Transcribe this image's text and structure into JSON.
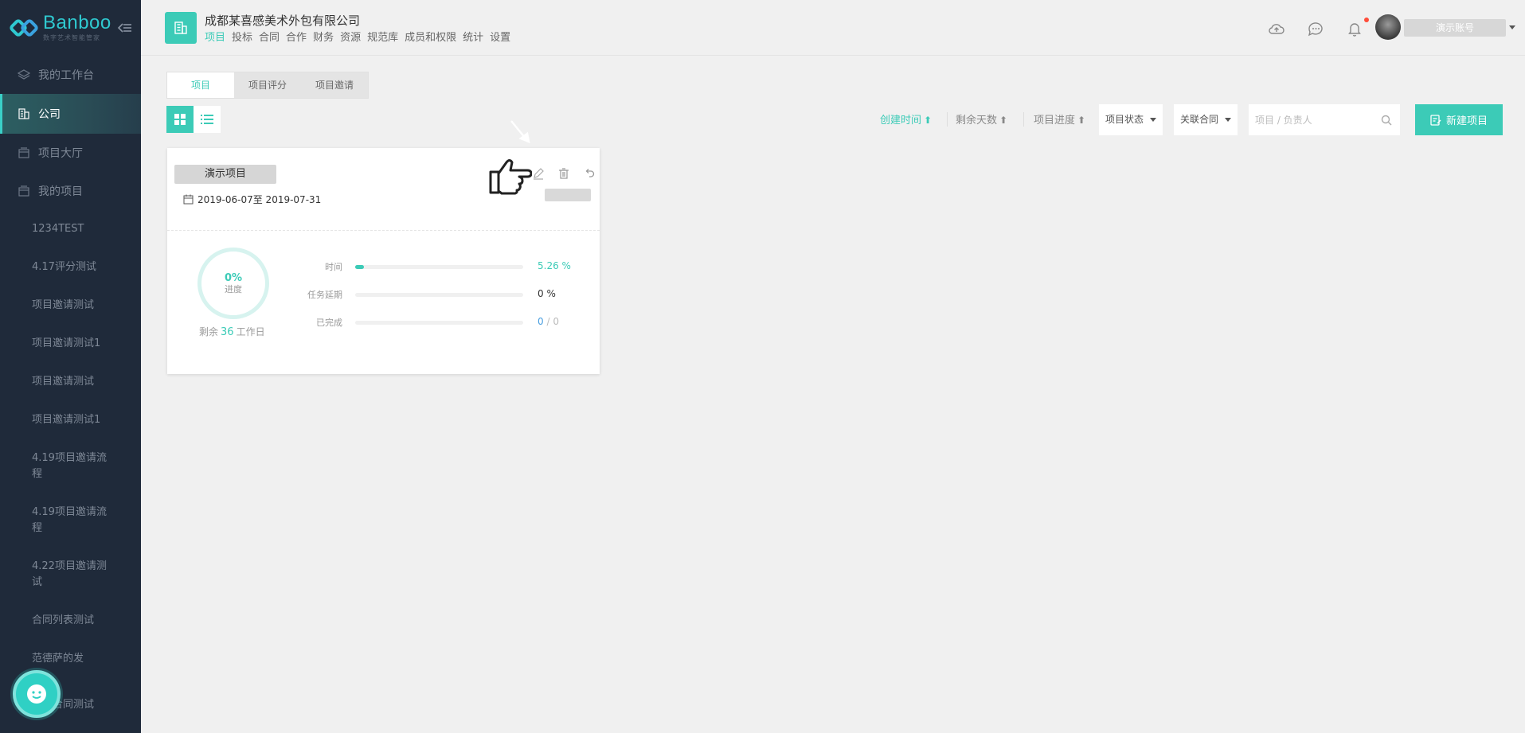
{
  "app": {
    "logo_title": "Banboo",
    "logo_subtitle": "数字艺术智能管家"
  },
  "sidebar": {
    "items": [
      {
        "label": "我的工作台",
        "icon": "layers-icon"
      },
      {
        "label": "公司",
        "icon": "building-icon",
        "active": true
      },
      {
        "label": "项目大厅",
        "icon": "box-icon"
      },
      {
        "label": "我的项目",
        "icon": "box-icon"
      }
    ],
    "projects": [
      "1234TEST",
      "4.17评分测试",
      "项目邀请测试",
      "项目邀请测试1",
      "项目邀请测试",
      "项目邀请测试1",
      "4.19项目邀请流程",
      "4.19项目邀请流程",
      "4.22项目邀请测试",
      "合同列表测试",
      "范德萨的发",
      "邀请合同测试"
    ]
  },
  "header": {
    "company_name": "成都某喜感美术外包有限公司",
    "menu": [
      "项目",
      "投标",
      "合同",
      "合作",
      "财务",
      "资源",
      "规范库",
      "成员和权限",
      "统计",
      "设置"
    ],
    "active_menu": "项目",
    "account_name": "演示账号"
  },
  "tabs": [
    {
      "label": "项目",
      "active": true
    },
    {
      "label": "项目评分"
    },
    {
      "label": "项目邀请"
    }
  ],
  "toolbar": {
    "sort_created": "创建时间",
    "sort_remaining": "剩余天数",
    "sort_progress": "项目进度",
    "status_filter": "项目状态",
    "contract_filter": "关联合同",
    "search_placeholder": "项目 / 负责人",
    "new_project": "新建项目"
  },
  "project_card": {
    "name": "演示项目",
    "date_range": "2019-06-07至 2019-07-31",
    "progress_pct": "0%",
    "progress_label": "进度",
    "remaining_prefix": "剩余",
    "remaining_days": "36",
    "remaining_suffix": "工作日",
    "stats": [
      {
        "name": "时间",
        "value": "5.26 %",
        "fraction": 0.0526
      },
      {
        "name": "任务延期",
        "value": "0 %",
        "fraction": 0
      },
      {
        "name": "已完成",
        "value_done": "0",
        "value_total": " / 0",
        "fraction": 0
      }
    ]
  },
  "colors": {
    "accent": "#3ccbb7",
    "sidebar_bg": "#1f2a3a",
    "link_blue": "#4a9fe0"
  }
}
